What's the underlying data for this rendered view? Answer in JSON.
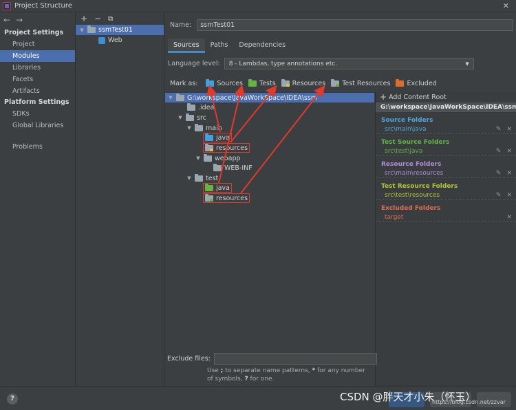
{
  "window": {
    "title": "Project Structure",
    "close_glyph": "✕"
  },
  "nav": {
    "back": "←",
    "forward": "→"
  },
  "sidebar": {
    "project_settings_title": "Project Settings",
    "project_items": [
      {
        "label": "Project"
      },
      {
        "label": "Modules",
        "selected": true
      },
      {
        "label": "Libraries"
      },
      {
        "label": "Facets"
      },
      {
        "label": "Artifacts"
      }
    ],
    "platform_settings_title": "Platform Settings",
    "platform_items": [
      {
        "label": "SDKs"
      },
      {
        "label": "Global Libraries"
      }
    ],
    "problems_label": "Problems"
  },
  "modules": {
    "toolbar": {
      "add": "+",
      "remove": "−",
      "copy": "⧉"
    },
    "items": [
      {
        "label": "ssmTest01",
        "selected": true
      },
      {
        "label": "Web"
      }
    ]
  },
  "main": {
    "name_label": "Name:",
    "name_value": "ssmTest01",
    "tabs": [
      {
        "label": "Sources",
        "active": true
      },
      {
        "label": "Paths"
      },
      {
        "label": "Dependencies"
      }
    ],
    "language_level_label": "Language level:",
    "language_level_value": "8 - Lambdas, type annotations etc.",
    "mark_as_label": "Mark as:",
    "mark_as": [
      {
        "label": "Sources",
        "icon": "sources-folder-icon"
      },
      {
        "label": "Tests",
        "icon": "tests-folder-icon"
      },
      {
        "label": "Resources",
        "icon": "resources-folder-icon"
      },
      {
        "label": "Test Resources",
        "icon": "test-resources-folder-icon"
      },
      {
        "label": "Excluded",
        "icon": "excluded-folder-icon"
      }
    ],
    "tree": {
      "root": "G:\\workspace\\JavaWorkSpace\\IDEA\\ssm",
      "idea": ".idea",
      "src": "src",
      "main": "main",
      "main_java": "java",
      "main_resources": "resources",
      "webapp": "webapp",
      "webinf": "WEB-INF",
      "test": "test",
      "test_java": "java",
      "test_resources": "resources"
    },
    "exclude_files_label": "Exclude files:",
    "hint_prefix": "Use ",
    "hint_semicolon": ";",
    "hint_mid": " to separate name patterns, ",
    "hint_star": "*",
    "hint_mid2": " for any number of symbols, ",
    "hint_q": "?",
    "hint_end": " for one."
  },
  "content_roots": {
    "add_label": "Add Content Root",
    "root_path": "G:\\workspace\\JavaWorkSpace\\IDEA\\ssm",
    "categories": [
      {
        "title": "Source Folders",
        "entry": "src\\main\\java",
        "color": "#4aa8e0"
      },
      {
        "title": "Test Source Folders",
        "entry": "src\\test\\java",
        "color": "#62b543"
      },
      {
        "title": "Resource Folders",
        "entry": "src\\main\\resources",
        "color": "#b08cd6"
      },
      {
        "title": "Test Resource Folders",
        "entry": "src\\test\\resources",
        "color": "#b5c531"
      },
      {
        "title": "Excluded Folders",
        "entry": "target",
        "color": "#e06c50"
      }
    ],
    "edit_glyph": "✎",
    "remove_glyph": "✕"
  },
  "footer": {
    "help": "?",
    "watermark": "CSDN @胖天才小朱（怀玉）",
    "watermark_url": "https://blog.csdn.net/zzvar"
  },
  "colors": {
    "accent_selection": "#4b6eaf",
    "annotation_red": "#e23a2a"
  }
}
